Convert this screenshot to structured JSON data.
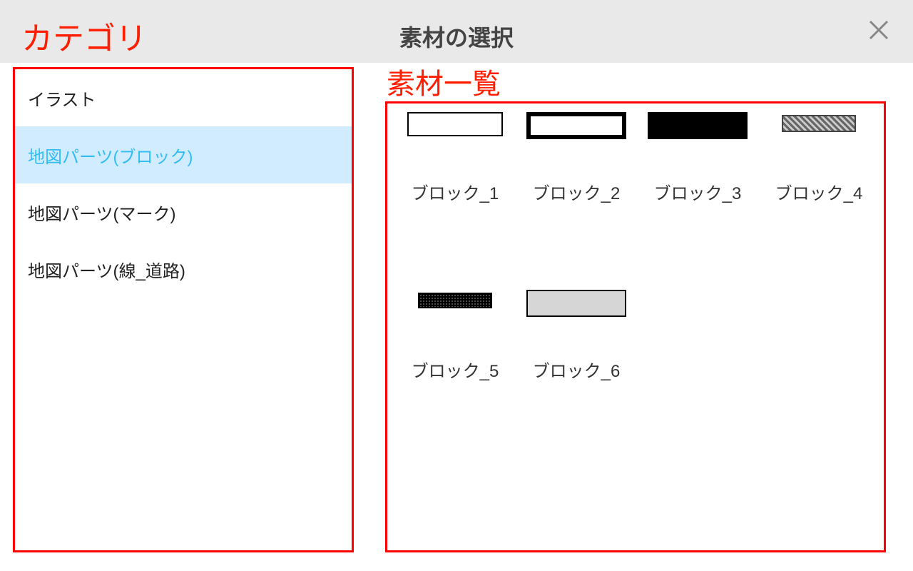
{
  "header": {
    "title": "素材の選択"
  },
  "labels": {
    "category": "カテゴリ",
    "material_list": "素材一覧"
  },
  "categories": [
    {
      "name": "イラスト",
      "selected": false
    },
    {
      "name": "地図パーツ(ブロック)",
      "selected": true
    },
    {
      "name": "地図パーツ(マーク)",
      "selected": false
    },
    {
      "name": "地図パーツ(線_道路)",
      "selected": false
    }
  ],
  "materials": [
    {
      "name": "ブロック_1",
      "style": "outline-thin"
    },
    {
      "name": "ブロック_2",
      "style": "outline-thick"
    },
    {
      "name": "ブロック_3",
      "style": "solid-black"
    },
    {
      "name": "ブロック_4",
      "style": "hatched"
    },
    {
      "name": "ブロック_5",
      "style": "dotted-dark"
    },
    {
      "name": "ブロック_6",
      "style": "solid-grey"
    }
  ]
}
